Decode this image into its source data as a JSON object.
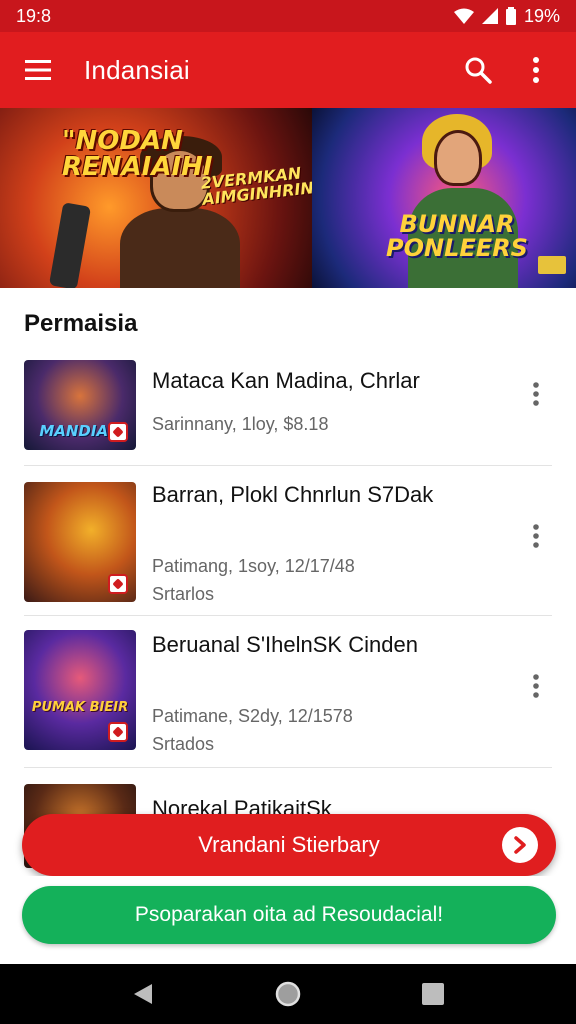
{
  "status_bar": {
    "time": "19:8",
    "battery_text": "19%"
  },
  "app_bar": {
    "title": "Indansiai"
  },
  "banner": {
    "left_title_1": "\"NODAN RENAIAIHI",
    "left_title_2": "2Vermkan AIMGINHRIN!",
    "right_title": "BUNNAR PONLEERS"
  },
  "section": {
    "title": "Permaisia"
  },
  "list": [
    {
      "title": "Mataca Kan Madina, Chrlar",
      "meta": "Sarinnany, 1loy, $8.18",
      "status": "",
      "thumb_label": "MANDIAN"
    },
    {
      "title": "Barran, Plokl Chnrlun S7Dak",
      "meta": "Patimang, 1soy, 12/17/48",
      "status": "Srtarlos",
      "thumb_label": ""
    },
    {
      "title": "Beruanal S'IhelnSK Cinden",
      "meta": "Patimane, S2dy, 12/1578",
      "status": "Srtados",
      "thumb_label": "PUMAK BIEIR"
    },
    {
      "title": "Norekal PatikaitSk",
      "meta": "",
      "status": "",
      "thumb_label": ""
    }
  ],
  "buttons": {
    "primary_label": "Vrandani Stierbary",
    "secondary_label": "Psoparakan oita ad Resoudacial!"
  },
  "colors": {
    "primary": "#e01e1f",
    "status_bar": "#c8161c",
    "green": "#14b15a"
  }
}
